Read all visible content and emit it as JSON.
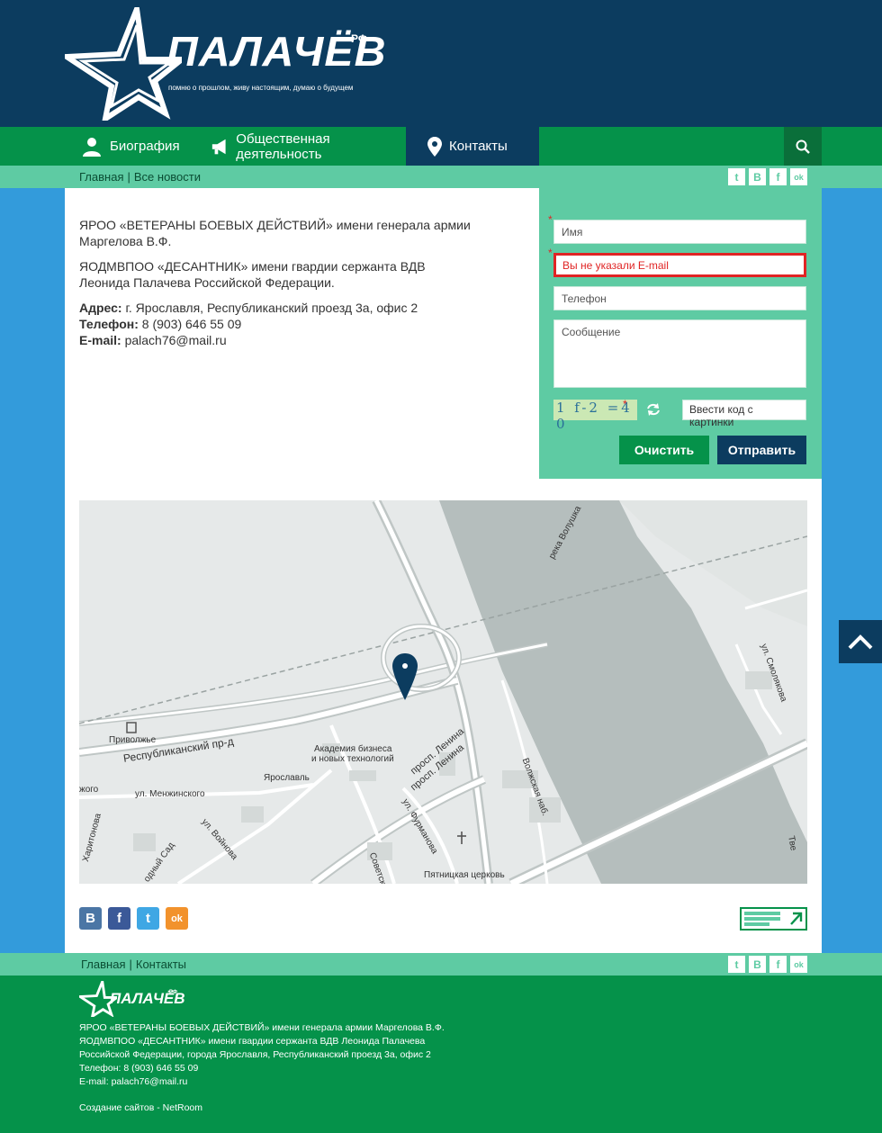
{
  "header": {
    "logo_text": "ПАЛАЧЁВ",
    "logo_rf": "РФ",
    "slogan": "помню о прошлом, живу настоящим, думаю о будущем"
  },
  "nav": {
    "items": [
      {
        "label": "Биография",
        "icon": "user-icon"
      },
      {
        "label": "Общественная деятельность",
        "icon": "megaphone-icon"
      },
      {
        "label": "Контакты",
        "icon": "location-pin-icon",
        "active": true
      }
    ],
    "search_icon": "search-icon"
  },
  "breadcrumbs": {
    "home": "Главная",
    "sep": "|",
    "news": "Все новости"
  },
  "social_small": [
    "t",
    "B",
    "f",
    "ok"
  ],
  "contacts": {
    "org1": "ЯРОО «ВЕТЕРАНЫ БОЕВЫХ ДЕЙСТВИЙ» имени генерала армии Маргелова В.Ф.",
    "org2": "ЯОДМВПОО «ДЕСАНТНИК» имени гвардии сержанта ВДВ Леонида Палачева Российской Федерации.",
    "address_label": "Адрес:",
    "address": " г. Ярославля, Республиканский проезд 3а, офис 2",
    "phone_label": "Телефон:",
    "phone": " 8 (903) 646 55 09",
    "email_label": "E-mail:",
    "email": " palach76@mail.ru"
  },
  "form": {
    "name_placeholder": "Имя",
    "email_error": "Вы не указали E-mail",
    "phone_placeholder": "Телефон",
    "message_placeholder": "Сообщение",
    "required_mark": "*",
    "captcha_placeholder": "Ввести код с картинки",
    "captcha_chars": "1 f-2 =4 0",
    "clear_label": "Очистить",
    "send_label": "Отправить"
  },
  "map": {
    "labels": {
      "river": "река Волушка",
      "station": "Приволжье",
      "street1": "Республиканский пр-д",
      "academy1": "Академия бизнеса",
      "academy2": "и новых технологий",
      "city": "Ярославль",
      "lenina1": "просп. Ленина",
      "lenina2": "просп. Ленина",
      "volzhskaya": "Волжская наб.",
      "smolyakova": "ул. Смолякова",
      "menzhinskogo": "ул. Менжинского",
      "voinova": "ул. Войнова",
      "furmanova": "ул. Фурманова",
      "church": "Пятницкая церковь",
      "sovetskaya": "Советская",
      "sad": "одный Сад",
      "haritonova": "Харитонова",
      "ko": "жого",
      "tv": "Тве"
    }
  },
  "bottom_social": [
    "B",
    "f",
    "t",
    "ok"
  ],
  "colors": {
    "navy": "#0c3c5f",
    "green": "#05924a",
    "mint": "#5ecba3",
    "blue": "#339bdb"
  },
  "footer_links": {
    "home": "Главная",
    "sep": "|",
    "contacts": "Контакты"
  },
  "footer": {
    "logo_text": "ПАЛАЧЁВ",
    "logo_rf": "РФ",
    "line1": "ЯРОО «ВЕТЕРАНЫ БОЕВЫХ ДЕЙСТВИЙ» имени генерала армии Маргелова В.Ф.",
    "line2": "ЯОДМВПОО «ДЕСАНТНИК» имени гвардии сержанта ВДВ Леонида Палачева",
    "line3": "Российской Федерации, города Ярославля, Республиканский проезд 3а, офис 2",
    "line4": "Телефон: 8 (903) 646 55 09",
    "line5": "E-mail: palach76@mail.ru",
    "made": "Создание сайтов -  NetRoom"
  }
}
